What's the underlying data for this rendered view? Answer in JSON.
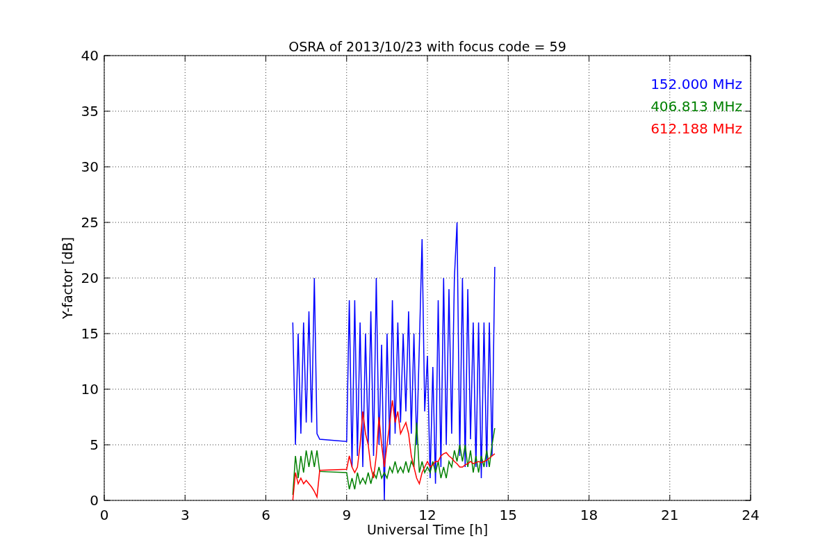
{
  "chart_data": {
    "type": "line",
    "grid": true,
    "title": "OSRA of 2013/10/23 with focus code = 59",
    "xlabel": "Universal Time [h]",
    "ylabel": "Y-factor [dB]",
    "xlim": [
      0,
      24
    ],
    "ylim": [
      0,
      40
    ],
    "xticks": [
      0,
      3,
      6,
      9,
      12,
      15,
      18,
      21,
      24
    ],
    "yticks": [
      0,
      5,
      10,
      15,
      20,
      25,
      30,
      35,
      40
    ],
    "x": [
      7.0,
      7.1,
      7.2,
      7.3,
      7.4,
      7.5,
      7.6,
      7.7,
      7.8,
      7.9,
      8.0,
      9.0,
      9.1,
      9.2,
      9.3,
      9.4,
      9.5,
      9.6,
      9.7,
      9.8,
      9.9,
      10.0,
      10.1,
      10.2,
      10.3,
      10.4,
      10.5,
      10.6,
      10.7,
      10.8,
      10.9,
      11.0,
      11.1,
      11.2,
      11.3,
      11.4,
      11.5,
      11.6,
      11.7,
      11.8,
      11.9,
      12.0,
      12.1,
      12.2,
      12.3,
      12.4,
      12.5,
      12.6,
      12.7,
      12.8,
      12.9,
      13.0,
      13.1,
      13.2,
      13.3,
      13.4,
      13.5,
      13.6,
      13.7,
      13.8,
      13.9,
      14.0,
      14.1,
      14.2,
      14.3,
      14.4,
      14.5
    ],
    "series": [
      {
        "name": "152.000 MHz",
        "color": "#0000ff",
        "values": [
          16,
          5,
          15,
          6,
          16,
          7,
          17,
          7,
          20,
          6,
          5.5,
          5.3,
          18,
          3,
          18,
          4,
          16,
          3,
          15,
          5,
          17,
          4,
          20,
          5,
          14,
          0,
          15,
          5,
          18,
          6,
          16,
          7,
          15,
          8,
          17,
          6,
          15,
          5,
          14,
          23.5,
          8,
          13,
          2,
          12,
          1.5,
          18,
          3,
          20,
          5,
          19,
          6,
          20,
          25,
          4,
          20,
          3,
          19,
          5.5,
          16,
          3,
          16,
          2,
          16,
          3,
          16,
          4,
          21
        ]
      },
      {
        "name": "406.813 MHz",
        "color": "#008000",
        "values": [
          0.5,
          4,
          2,
          4,
          2.5,
          4.5,
          3,
          4.5,
          3,
          4.5,
          2.6,
          2.5,
          1,
          2,
          1,
          2.5,
          1.5,
          2,
          1.5,
          2.5,
          1.5,
          2.5,
          2,
          3,
          2,
          2.5,
          2,
          3,
          2.5,
          3.5,
          2.5,
          3,
          2.5,
          3.5,
          2.5,
          3.5,
          3,
          7,
          2.5,
          3.5,
          2.5,
          3,
          2.5,
          3.5,
          2.5,
          3.5,
          2,
          3,
          2,
          3.5,
          3,
          4.5,
          3.5,
          5,
          3.5,
          5,
          3,
          4.5,
          2.5,
          4,
          2.5,
          4,
          3,
          4.5,
          3,
          5,
          6.5
        ]
      },
      {
        "name": "612.188 MHz",
        "color": "#ff0000",
        "values": [
          0,
          2.5,
          1.5,
          2,
          1.5,
          1.8,
          1.5,
          1.2,
          0.8,
          0.3,
          2.7,
          2.8,
          4,
          3,
          2.5,
          3,
          5,
          8,
          6,
          5,
          3,
          2,
          4,
          7.5,
          5,
          3,
          5,
          7,
          9,
          7,
          8,
          6,
          6.5,
          7,
          6,
          4,
          3,
          2,
          1.5,
          2.5,
          3,
          3.5,
          3,
          3.2,
          3.5,
          3.5,
          4,
          4.2,
          4.3,
          4,
          3.8,
          3.5,
          3.3,
          3,
          3,
          3.2,
          3.3,
          3.5,
          3.3,
          3.4,
          3.5,
          3.4,
          3.5,
          3.6,
          3.8,
          4,
          4.2
        ]
      }
    ]
  }
}
